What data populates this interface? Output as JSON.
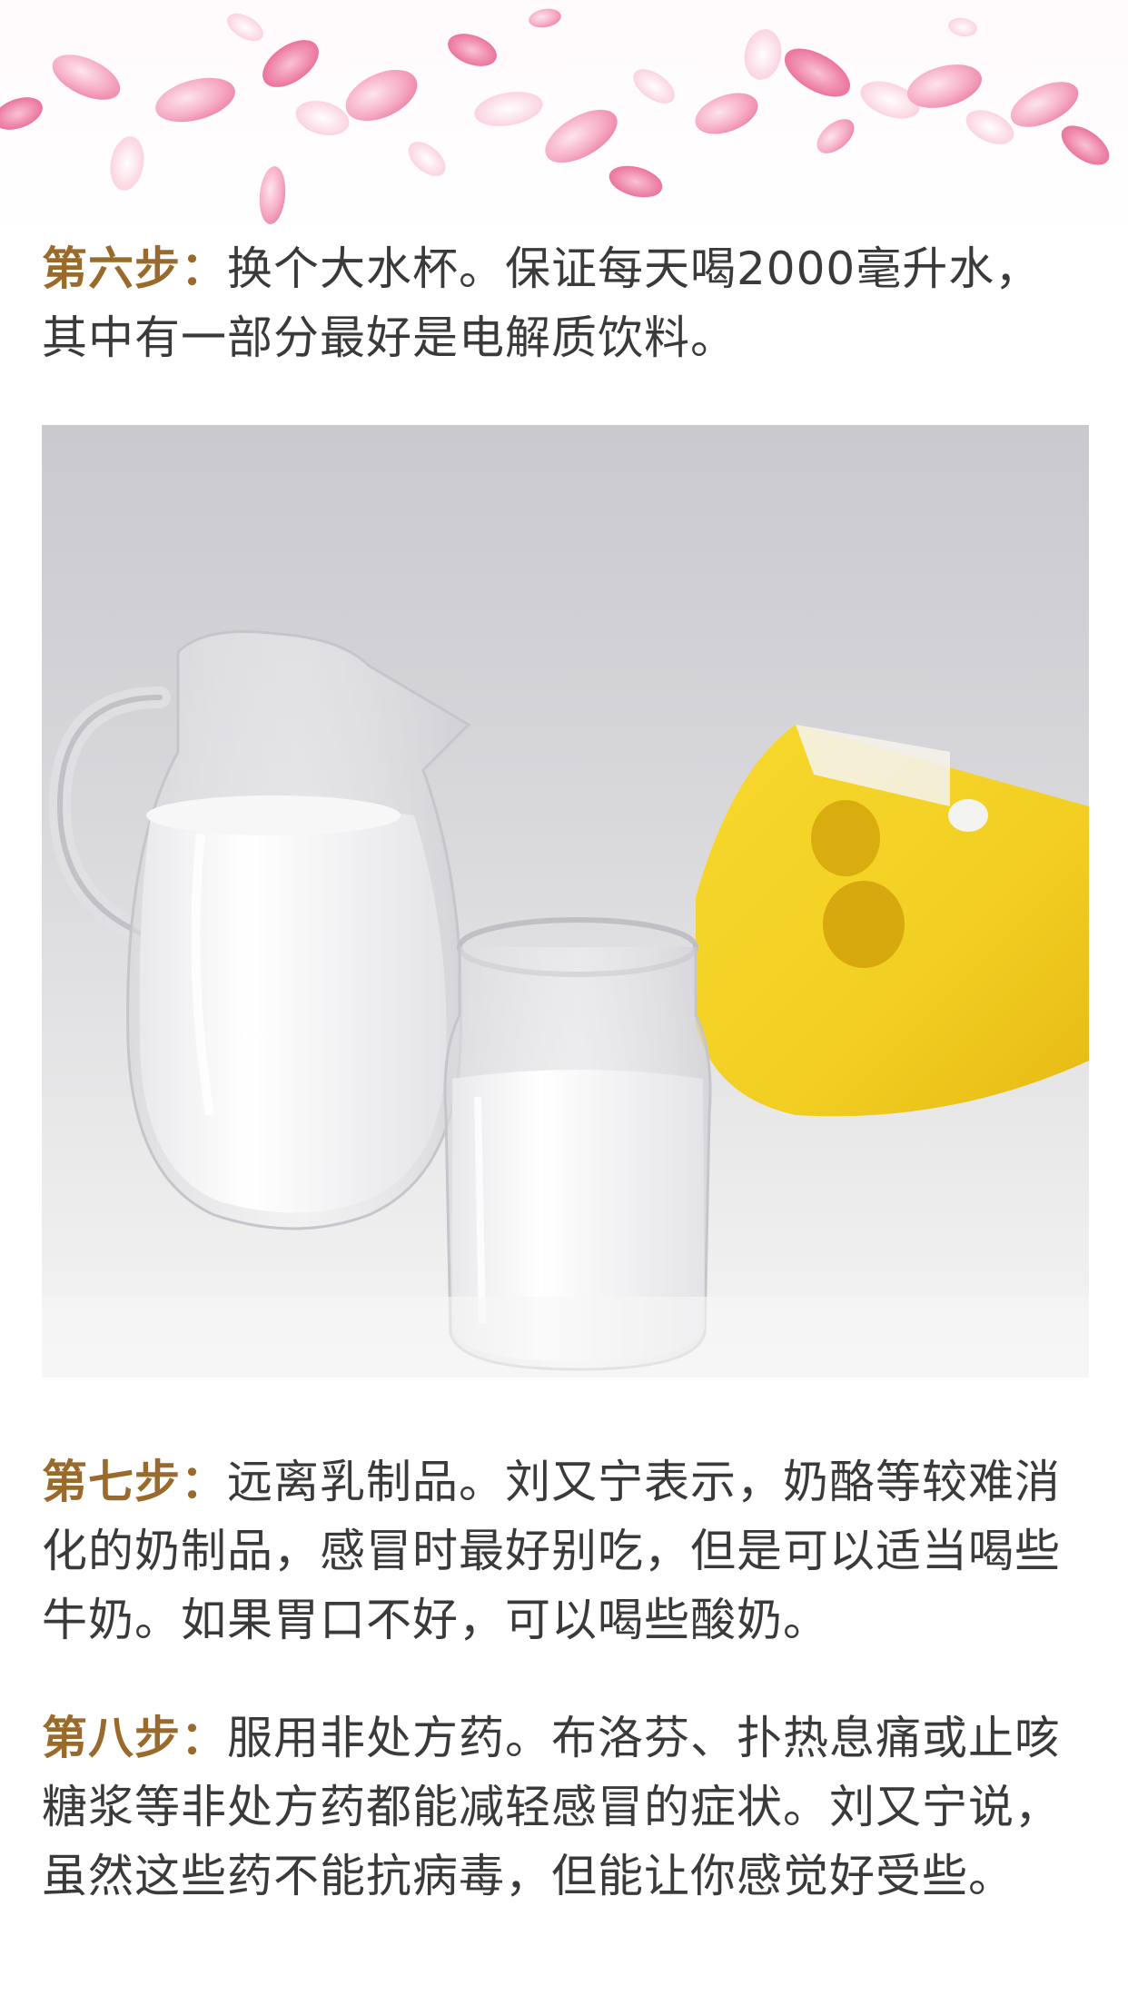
{
  "steps": [
    {
      "label": "第六步：",
      "text": "换个大水杯。保证每天喝2000毫升水，其中有一部分最好是电解质饮料。"
    },
    {
      "label": "第七步：",
      "text": "远离乳制品。刘又宁表示，奶酪等较难消化的奶制品，感冒时最好别吃，但是可以适当喝些牛奶。如果胃口不好，可以喝些酸奶。"
    },
    {
      "label": "第八步：",
      "text": "服用非处方药。布洛芬、扑热息痛或止咳糖浆等非处方药都能减轻感冒的症状。刘又宁说，虽然这些药不能抗病毒，但能让你感觉好受些。"
    }
  ],
  "colors": {
    "step_label": "#9a6a2c",
    "body_text": "#3a3a3a",
    "petal_pink": "#f29ab6"
  }
}
